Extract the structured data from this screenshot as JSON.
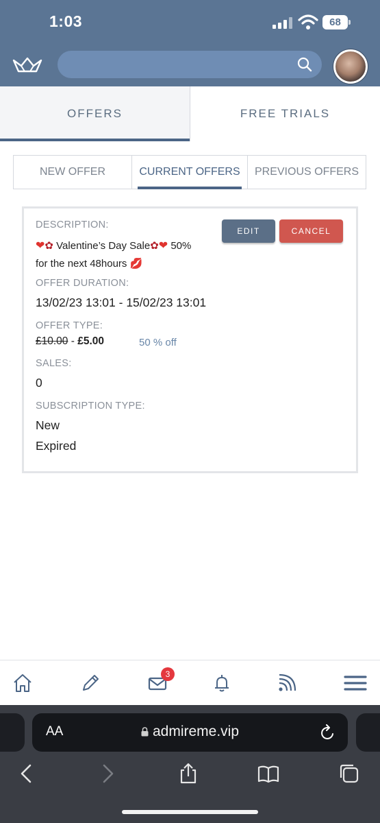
{
  "status_bar": {
    "time": "1:03",
    "battery": "68",
    "icons": [
      "signal-icon",
      "wifi-icon",
      "battery-icon"
    ]
  },
  "header": {
    "logo": "crown-logo-icon",
    "search_icon": "search-icon",
    "avatar": "user-avatar"
  },
  "main_tabs": [
    {
      "label": "OFFERS",
      "active": true
    },
    {
      "label": "FREE TRIALS",
      "active": false
    }
  ],
  "sub_tabs": [
    {
      "label": "NEW OFFER",
      "active": false
    },
    {
      "label": "CURRENT OFFERS",
      "active": true
    },
    {
      "label": "PREVIOUS OFFERS",
      "active": false
    }
  ],
  "offer": {
    "description_label": "DESCRIPTION:",
    "description_line1": "Valentine’s Day Sale",
    "description_pct": "50%",
    "description_line2": "for the next 48hours",
    "duration_label": "OFFER DURATION:",
    "duration": "13/02/23 13:01 - 15/02/23 13:01",
    "type_label": "OFFER TYPE:",
    "price_old": "£10.00",
    "price_sep": " - ",
    "price_new": "£5.00",
    "discount": "50 % off",
    "sales_label": "SALES:",
    "sales": "0",
    "subscription_label": "SUBSCRIPTION TYPE:",
    "subscription_types": [
      "New",
      "Expired"
    ],
    "edit_label": "EDIT",
    "cancel_label": "CANCEL"
  },
  "bottom_nav": {
    "items": [
      "home-icon",
      "pencil-icon",
      "mail-icon",
      "bell-icon",
      "feed-icon",
      "menu-icon"
    ],
    "mail_badge": "3"
  },
  "browser": {
    "aa_label": "AA",
    "url": "admireme.vip"
  },
  "colors": {
    "header_bg": "#5b7594",
    "accent": "#4b6586",
    "cancel": "#d0574f",
    "edit": "#5b6f87",
    "badge": "#e4383e"
  }
}
